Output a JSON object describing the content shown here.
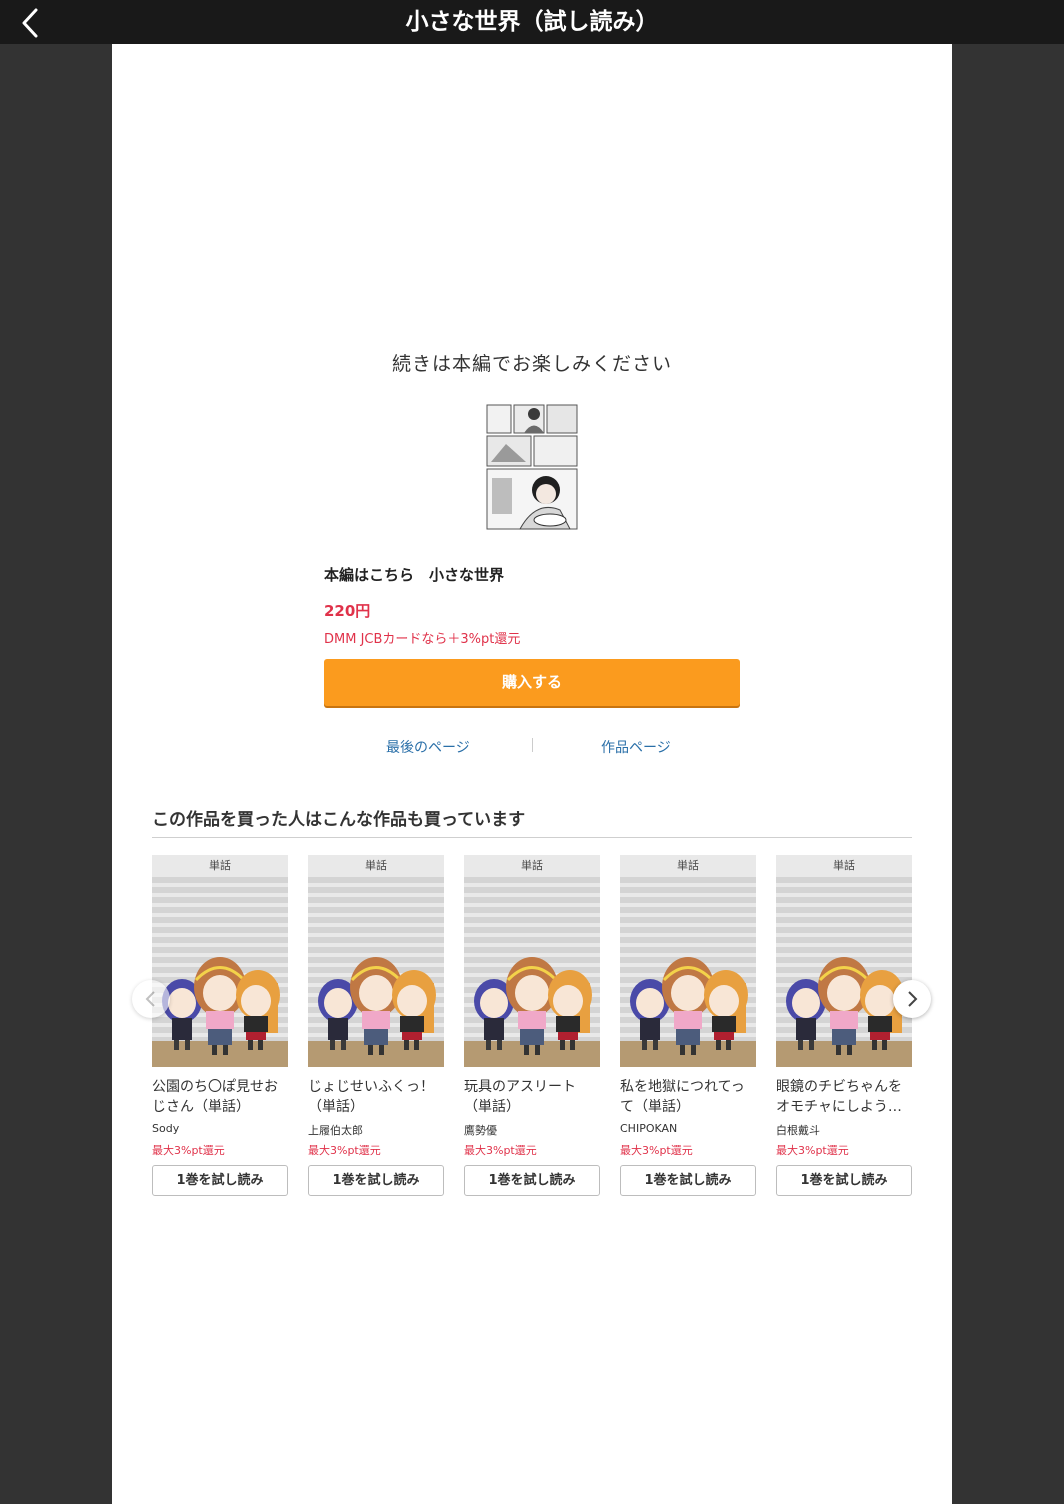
{
  "header": {
    "title": "小さな世界（試し読み）",
    "back_icon": "chevron-left-icon"
  },
  "end_section": {
    "message": "続きは本編でお楽しみください",
    "main_title": "本編はこちら　小さな世界",
    "price": "220円",
    "point_note": "DMM JCBカードなら＋3%pt還元",
    "buy_label": "購入する",
    "last_page_link": "最後のページ",
    "product_page_link": "作品ページ"
  },
  "recommendations": {
    "heading": "この作品を買った人はこんな作品も買っています",
    "items": [
      {
        "label": "単話",
        "title": "公園のち〇ぽ見せおじさん（単話）",
        "author": "Sody",
        "point": "最大3%pt還元",
        "button": "1巻を試し読み"
      },
      {
        "label": "単話",
        "title": "じょじせいふくっ！（単話）",
        "author": "上履伯太郎",
        "point": "最大3%pt還元",
        "button": "1巻を試し読み"
      },
      {
        "label": "単話",
        "title": "玩具のアスリート（単話）",
        "author": "鷹勢優",
        "point": "最大3%pt還元",
        "button": "1巻を試し読み"
      },
      {
        "label": "単話",
        "title": "私を地獄につれてって（単話）",
        "author": "CHIPOKAN",
        "point": "最大3%pt還元",
        "button": "1巻を試し読み"
      },
      {
        "label": "単話",
        "title": "眼鏡のチビちゃんをオモチャにしよう…",
        "author": "白根戴斗",
        "point": "最大3%pt還元",
        "button": "1巻を試し読み"
      }
    ]
  },
  "colors": {
    "accent": "#fb9b1e",
    "price": "#e0324a",
    "link": "#2a6fa8",
    "topbar": "#191919",
    "backdrop": "#333333"
  }
}
